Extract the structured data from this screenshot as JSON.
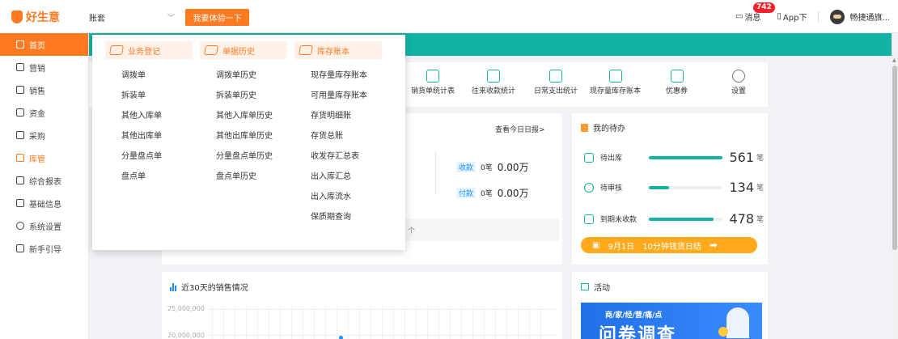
{
  "brand": {
    "name": "好生意",
    "color": "#ff7a21"
  },
  "header": {
    "account_value": "账套",
    "trial_button": "我要体验一下",
    "message_label": "消息",
    "message_count": "742",
    "app_label": "App下",
    "user_name": "畅捷通旗..."
  },
  "sidebar": {
    "items": [
      {
        "label": "首页",
        "icon": "home-icon"
      },
      {
        "label": "营销",
        "icon": "gift-icon"
      },
      {
        "label": "销售",
        "icon": "sales-icon"
      },
      {
        "label": "资金",
        "icon": "money-icon"
      },
      {
        "label": "采购",
        "icon": "purchase-icon"
      },
      {
        "label": "库管",
        "icon": "warehouse-icon"
      },
      {
        "label": "综合报表",
        "icon": "report-icon"
      },
      {
        "label": "基础信息",
        "icon": "info-icon"
      },
      {
        "label": "系统设置",
        "icon": "settings-icon"
      },
      {
        "label": "新手引导",
        "icon": "guide-icon"
      }
    ]
  },
  "mega_menu": {
    "columns": [
      {
        "title": "业务登记",
        "links": [
          "调拨单",
          "拆装单",
          "其他入库单",
          "其他出库单",
          "分量盘点单",
          "盘点单"
        ]
      },
      {
        "title": "单据历史",
        "links": [
          "调拨单历史",
          "拆装单历史",
          "其他入库单历史",
          "其他出库单历史",
          "分量盘点单历史",
          "盘点单历史"
        ]
      },
      {
        "title": "库存账本",
        "links": [
          "现存量库存账本",
          "可用量库存账本",
          "存货明细账",
          "存货总账",
          "收发存汇总表",
          "出入库汇总",
          "出入库流水",
          "保质期查询"
        ]
      }
    ]
  },
  "quick_links": [
    {
      "label": "销货单统计表"
    },
    {
      "label": "往来收款统计"
    },
    {
      "label": "日常支出统计"
    },
    {
      "label": "现存量库存账本"
    },
    {
      "label": "优惠券"
    },
    {
      "label": "设置"
    }
  ],
  "today": {
    "view_link": "查看今日日报>",
    "receipt_tag": "收款",
    "receipt_count": "0笔",
    "receipt_amount": "0.00万",
    "payment_tag": "付款",
    "payment_count": "0笔",
    "payment_amount": "0.00万",
    "gray_text": "个"
  },
  "todo": {
    "title": "我的待办",
    "items": [
      {
        "label": "待出库",
        "value": "561",
        "unit": "笔",
        "fill_pct": 100
      },
      {
        "label": "待审核",
        "value": "134",
        "unit": "笔",
        "fill_pct": 28
      },
      {
        "label": "到期未收款",
        "value": "478",
        "unit": "笔",
        "fill_pct": 88
      }
    ],
    "promo_date": "9月1日",
    "promo_text": "10分钟钱货日结"
  },
  "sales_chart": {
    "title": "近30天的销售情况",
    "y_ticks": [
      "25,000,000",
      "20,000,000"
    ]
  },
  "activity": {
    "title": "活动",
    "banner_small": "商/家/经/营/痛/点",
    "banner_big": "问卷调查"
  }
}
